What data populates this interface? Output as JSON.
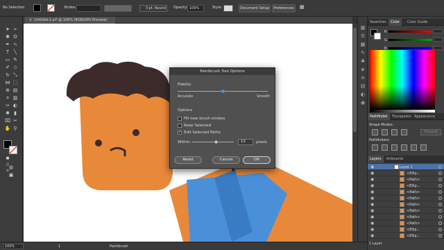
{
  "control_bar": {
    "selection": "No Selection",
    "stroke_label": "Stroke:",
    "brush": "3 pt. Round",
    "opacity_label": "Opacity:",
    "opacity": "100%",
    "style_label": "Style:",
    "document_setup": "Document Setup",
    "preferences": "Preferences"
  },
  "document_tab": {
    "title": "Untitled-1.ai* @ 100% (RGB/GPU Preview)",
    "close": "×"
  },
  "color_panel": {
    "tabs": [
      "Swatches",
      "Color",
      "Color Guide"
    ],
    "active_tab": "Color",
    "channels": [
      {
        "label": "R",
        "color": "#ff0000"
      },
      {
        "label": "G",
        "color": "#00aa00"
      },
      {
        "label": "B",
        "color": "#0000ff"
      }
    ]
  },
  "pathfinder_panel": {
    "tabs": [
      "Pathfinder",
      "Transparen",
      "Appearance"
    ],
    "shape_modes_label": "Shape Modes:",
    "expand_label": "Expand",
    "pathfinders_label": "Pathfinders:"
  },
  "layers_panel": {
    "tabs": [
      "Layers",
      "Artboards"
    ],
    "layers": [
      {
        "name": "Layer 1",
        "selected": true
      },
      {
        "name": "<Ellip..."
      },
      {
        "name": "<Path>"
      },
      {
        "name": "<Ellip..."
      },
      {
        "name": "<Path>"
      },
      {
        "name": "<Path>"
      },
      {
        "name": "<Path>"
      },
      {
        "name": "<Path>"
      },
      {
        "name": "<Path>"
      },
      {
        "name": "<Path>"
      },
      {
        "name": "<Ellip..."
      },
      {
        "name": "<Ellip..."
      }
    ],
    "footer": "1 Layer"
  },
  "status_bar": {
    "zoom": "100%",
    "artboard": "1",
    "tool": "Paintbrush"
  },
  "dialog": {
    "title": "Paintbrush Tool Options",
    "fidelity_label": "Fidelity",
    "accurate": "Accurate",
    "smooth": "Smooth",
    "fidelity_value": 0.5,
    "options_label": "Options",
    "options": [
      {
        "label": "Fill new brush strokes",
        "checked": false
      },
      {
        "label": "Keep Selected",
        "checked": false
      },
      {
        "label": "Edit Selected Paths",
        "checked": true
      }
    ],
    "within_label": "Within:",
    "within_value": "12",
    "within_unit": "pixels",
    "buttons": {
      "reset": "Reset",
      "cancel": "Cancel",
      "ok": "OK"
    }
  },
  "colors": {
    "skin": "#e8893a",
    "hair": "#3d2b2b",
    "shirt": "#4a90d9",
    "shirt_dark": "#3a7cc4",
    "dialog_accent": "#4a90e2"
  }
}
